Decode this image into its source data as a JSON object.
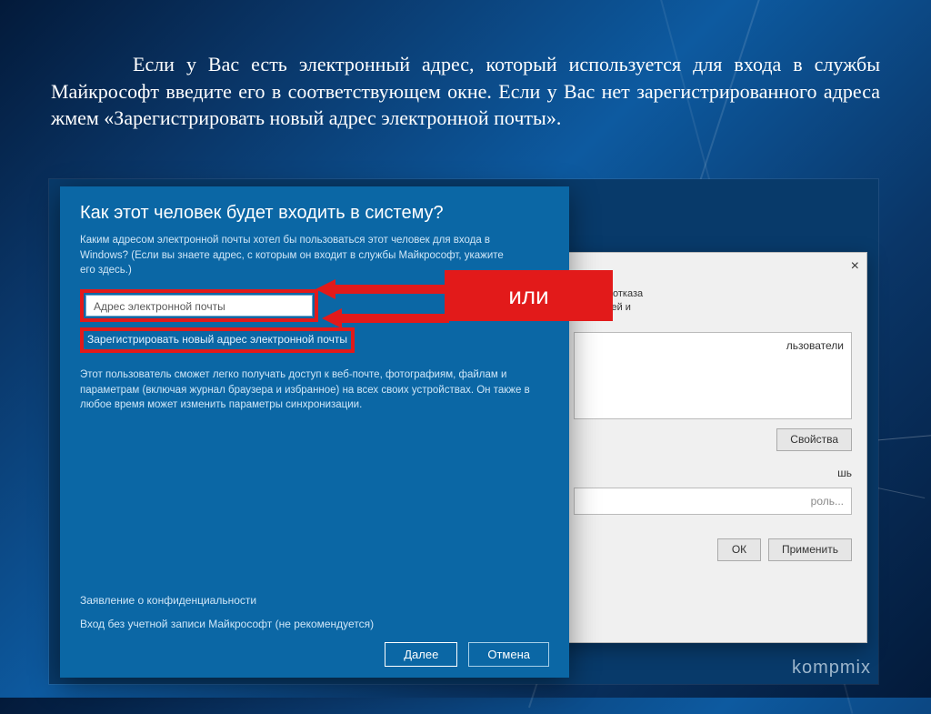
{
  "slide": {
    "text": "Если у Вас есть электронный адрес, который используется для входа в службы Майкрософт введите его в соответствующем окне. Если у Вас нет зарегистрированного адреса жмем «Зарегистрировать новый адрес электронной почты»."
  },
  "front": {
    "title": "Как этот человек будет входить в систему?",
    "sub": "Каким адресом электронной почты хотел бы пользоваться этот человек для входа в Windows? (Если вы знаете адрес, с которым он входит в службы Майкрософт, укажите его здесь.)",
    "email_placeholder": "Адрес электронной почты",
    "register_link": "Зарегистрировать новый адрес электронной почты",
    "note": "Этот пользователь сможет легко получать доступ к веб-почте, фотографиям, файлам и параметрам (включая журнал браузера и избранное) на всех своих устройствах. Он также в любое время может изменить параметры синхронизации.",
    "privacy": "Заявление о конфиденциальности",
    "nomsa": "Вход без учетной записи Майкрософт (не рекомендуется)",
    "next": "Далее",
    "cancel": "Отмена"
  },
  "or_label": "или",
  "back": {
    "hint1": "ния или отказа",
    "hint2": "ы паролей и",
    "list_header": "льзователи",
    "btn_props": "Свойства",
    "sub_label": "шь",
    "pw_placeholder": "роль...",
    "ok": "ОК",
    "apply": "Применить"
  },
  "watermark": "kompmix"
}
